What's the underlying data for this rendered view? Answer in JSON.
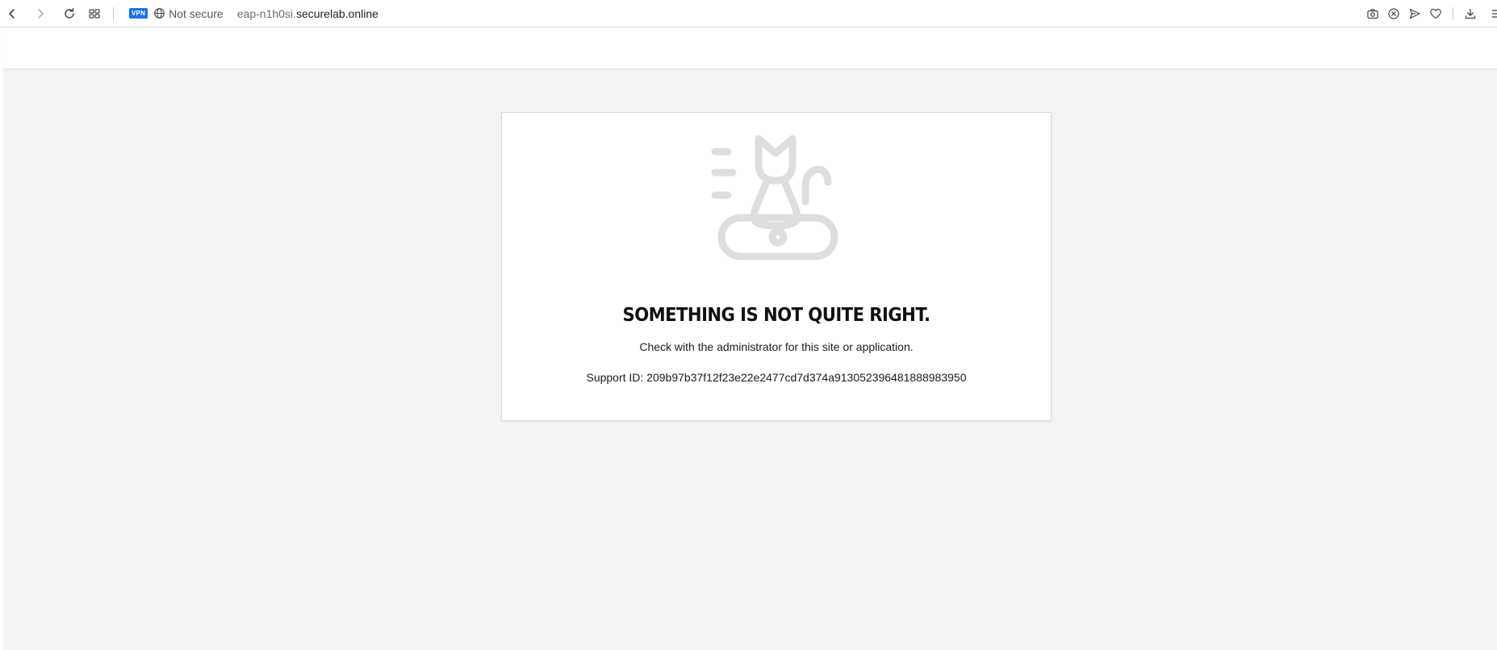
{
  "browser": {
    "vpn_label": "VPN",
    "security_label": "Not secure",
    "url_subdomain": "eap-n1h0si.",
    "url_domain": "securelab.online",
    "icons": {
      "back": "back-arrow-icon",
      "forward": "forward-arrow-icon",
      "reload": "reload-icon",
      "tabs": "tab-grid-icon",
      "globe": "globe-icon",
      "camera": "camera-icon",
      "block": "close-circle-icon",
      "send": "send-icon",
      "heart": "heart-icon",
      "download": "download-icon",
      "menu": "menu-icon"
    },
    "accent_color": "#1a73e8"
  },
  "error_card": {
    "illustration_icon": "cat-on-cushion-icon",
    "illustration_color": "#dedede",
    "title": "SOMETHING IS NOT QUITE RIGHT.",
    "message": "Check with the administrator for this site or application.",
    "support_label": "Support ID: ",
    "support_id": "209b97b37f12f23e22e2477cd7d374a913052396481888983950"
  },
  "page_background": "#f4f4f4"
}
